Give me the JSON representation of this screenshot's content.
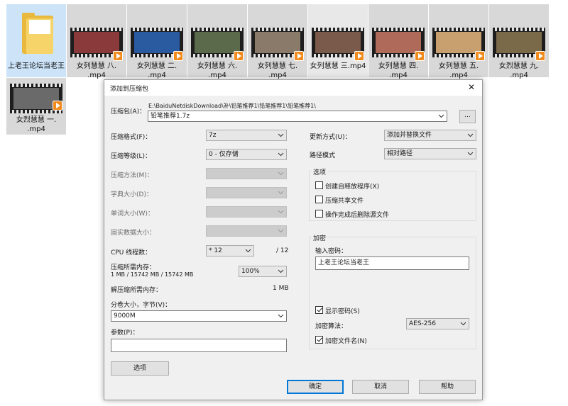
{
  "files": [
    {
      "name": "上老王论坛当老王",
      "type": "folder"
    },
    {
      "name": "女列慧慧 八.",
      "ext": ".mp4",
      "type": "video",
      "thumb": "#8a3a3a"
    },
    {
      "name": "女列慧慧 二.",
      "ext": ".mp4",
      "type": "video",
      "thumb": "#2a5aa0"
    },
    {
      "name": "女列慧慧 六.",
      "ext": ".mp4",
      "type": "video",
      "thumb": "#5a6a4a"
    },
    {
      "name": "女列慧慧 七.",
      "ext": ".mp4",
      "type": "video",
      "thumb": "#8a7a6a"
    },
    {
      "name": "女列慧慧 三.mp4",
      "ext": "",
      "type": "video",
      "thumb": "#7a5a4a"
    },
    {
      "name": "女列慧慧 四.",
      "ext": ".mp4",
      "type": "video",
      "thumb": "#b06a5a"
    },
    {
      "name": "女列慧慧 五.",
      "ext": ".mp4",
      "type": "video",
      "thumb": "#c8a070"
    },
    {
      "name": "女烈慧慧 九.",
      "ext": ".mp4",
      "type": "video",
      "thumb": "#7a6a4a"
    },
    {
      "name": "女烈慧慧 一.",
      "ext": ".mp4",
      "type": "video",
      "thumb": "#6a6a6a"
    }
  ],
  "dialog": {
    "title": "添加到压缩包",
    "close": "✕",
    "archive": {
      "label": "压缩包(A)：",
      "path": "E:\\BaiduNetdiskDownload\\补\\铅笔推荐1\\铅笔推荐1\\铅笔推荐1\\",
      "value": "铅笔推荐1.7z",
      "browse": "..."
    },
    "format": {
      "label": "压缩格式(F)：",
      "value": "7z"
    },
    "level": {
      "label": "压缩等级(L)：",
      "value": "0 - 仅存储"
    },
    "method": {
      "label": "压缩方法(M)："
    },
    "dict": {
      "label": "字典大小(D)："
    },
    "word": {
      "label": "单词大小(W)："
    },
    "solid": {
      "label": "固实数据大小："
    },
    "threads": {
      "label": "CPU 线程数：",
      "value": "* 12",
      "max": "/ 12"
    },
    "mem_comp": {
      "label": "压缩所需内存：",
      "detail": "1 MB / 15742 MB / 15742 MB",
      "value": "100%"
    },
    "mem_decomp": {
      "label": "解压缩所需内存：",
      "value": "1 MB"
    },
    "split": {
      "label": "分卷大小，字节(V)：",
      "value": "9000M"
    },
    "params": {
      "label": "参数(P)：",
      "value": ""
    },
    "options_button": "选项",
    "update": {
      "label": "更新方式(U)：",
      "value": "添加并替换文件"
    },
    "path_mode": {
      "label": "路径模式",
      "value": "相对路径"
    },
    "options_group": {
      "title": "选项",
      "sfx": "创建自释放程序(X)",
      "shared": "压缩共享文件",
      "delete": "操作完成后删除源文件"
    },
    "encrypt_group": {
      "title": "加密",
      "password_label": "输入密码：",
      "password": "上老王论坛当老王",
      "show_password": "显示密码(S)",
      "method_label": "加密算法：",
      "method": "AES-256",
      "encrypt_names": "加密文件名(N)"
    },
    "ok": "确定",
    "cancel": "取消",
    "help": "帮助"
  }
}
